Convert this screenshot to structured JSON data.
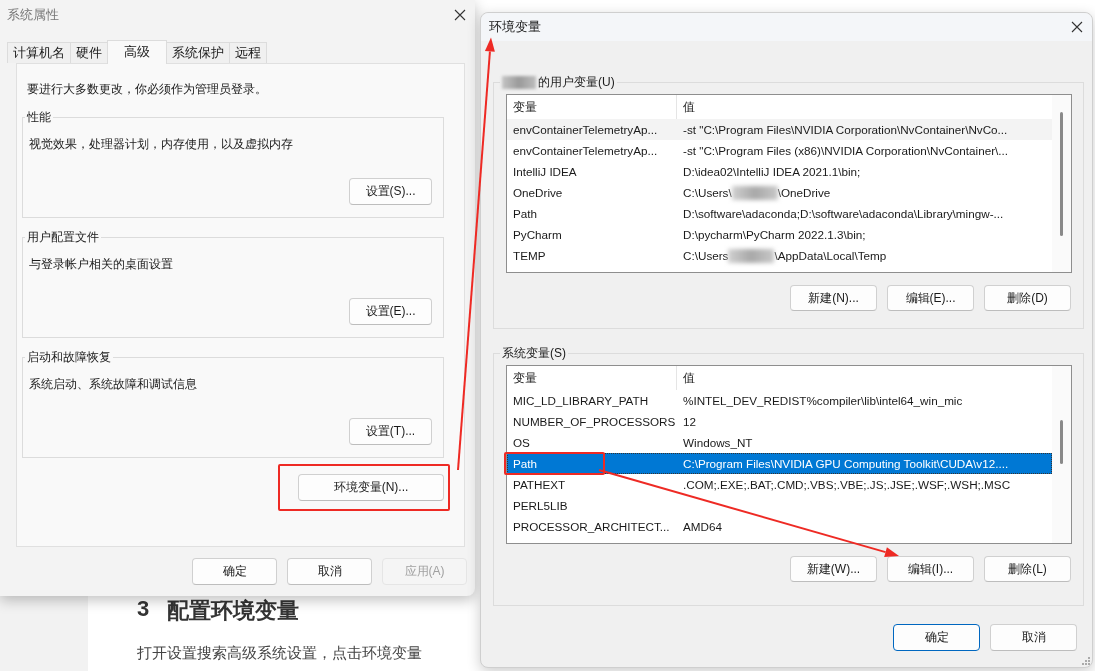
{
  "article": {
    "number": "3",
    "heading": "配置环境变量",
    "paragraph": "打开设置搜索高级系统设置，点击环境变量"
  },
  "system_properties": {
    "title": "系统属性",
    "tabs": [
      {
        "label": "计算机名",
        "selected": false
      },
      {
        "label": "硬件",
        "selected": false
      },
      {
        "label": "高级",
        "selected": true
      },
      {
        "label": "系统保护",
        "selected": false
      },
      {
        "label": "远程",
        "selected": false
      }
    ],
    "notice": "要进行大多数更改，你必须作为管理员登录。",
    "groups": [
      {
        "title": "性能",
        "description": "视觉效果，处理器计划，内存使用，以及虚拟内存",
        "button": "设置(S)..."
      },
      {
        "title": "用户配置文件",
        "description": "与登录帐户相关的桌面设置",
        "button": "设置(E)..."
      },
      {
        "title": "启动和故障恢复",
        "description": "系统启动、系统故障和调试信息",
        "button": "设置(T)..."
      }
    ],
    "env_button": "环境变量(N)...",
    "buttons": [
      {
        "label": "确定",
        "disabled": false
      },
      {
        "label": "取消",
        "disabled": false
      },
      {
        "label": "应用(A)",
        "disabled": true
      }
    ]
  },
  "environment_variables": {
    "title": "环境变量",
    "user_variables": {
      "label": "的用户变量(U)",
      "redacted_prefix": true,
      "columns": [
        "变量",
        "值"
      ],
      "rows": [
        {
          "name": "envContainerTelemetryAp...",
          "value": "-st \"C:\\Program Files\\NVIDIA Corporation\\NvContainer\\NvCo...",
          "hovered": true,
          "selected": false
        },
        {
          "name": "envContainerTelemetryAp...",
          "value": "-st \"C:\\Program Files (x86)\\NVIDIA Corporation\\NvContainer\\...",
          "hovered": false,
          "selected": false
        },
        {
          "name": "IntelliJ IDEA",
          "value": "D:\\idea02\\IntelliJ IDEA 2021.1\\bin;",
          "hovered": false,
          "selected": false
        },
        {
          "name": "OneDrive",
          "value_parts": [
            "C:\\Users\\",
            "\\OneDrive"
          ],
          "hovered": false,
          "selected": false
        },
        {
          "name": "Path",
          "value": "D:\\software\\adaconda;D:\\software\\adaconda\\Library\\mingw-...",
          "hovered": false,
          "selected": false
        },
        {
          "name": "PyCharm",
          "value": "D:\\pycharm\\PyCharm 2022.1.3\\bin;",
          "hovered": false,
          "selected": false
        },
        {
          "name": "TEMP",
          "value_parts": [
            "C:\\Users",
            "\\AppData\\Local\\Temp"
          ],
          "hovered": false,
          "selected": false
        }
      ],
      "buttons": [
        "新建(N)...",
        "编辑(E)...",
        "删除(D)"
      ]
    },
    "system_variables": {
      "label": "系统变量(S)",
      "redacted_prefix": false,
      "columns": [
        "变量",
        "值"
      ],
      "rows": [
        {
          "name": "MIC_LD_LIBRARY_PATH",
          "value": "%INTEL_DEV_REDIST%compiler\\lib\\intel64_win_mic",
          "hovered": false,
          "selected": false
        },
        {
          "name": "NUMBER_OF_PROCESSORS",
          "value": "12",
          "hovered": false,
          "selected": false
        },
        {
          "name": "OS",
          "value": "Windows_NT",
          "hovered": false,
          "selected": false
        },
        {
          "name": "Path",
          "value": "C:\\Program Files\\NVIDIA GPU Computing Toolkit\\CUDA\\v12....",
          "hovered": false,
          "selected": true
        },
        {
          "name": "PATHEXT",
          "value": ".COM;.EXE;.BAT;.CMD;.VBS;.VBE;.JS;.JSE;.WSF;.WSH;.MSC",
          "hovered": false,
          "selected": false
        },
        {
          "name": "PERL5LIB",
          "hovered": false,
          "selected": false
        },
        {
          "name": "PROCESSOR_ARCHITECT...",
          "value": "AMD64",
          "hovered": false,
          "selected": false
        }
      ],
      "buttons": [
        "新建(W)...",
        "编辑(I)...",
        "删除(L)"
      ]
    },
    "buttons": [
      {
        "label": "确定",
        "default": true
      },
      {
        "label": "取消",
        "default": false
      }
    ]
  },
  "annotations": [
    {
      "kind": "box"
    },
    {
      "kind": "arrow"
    },
    {
      "kind": "box"
    },
    {
      "kind": "arrow"
    }
  ]
}
